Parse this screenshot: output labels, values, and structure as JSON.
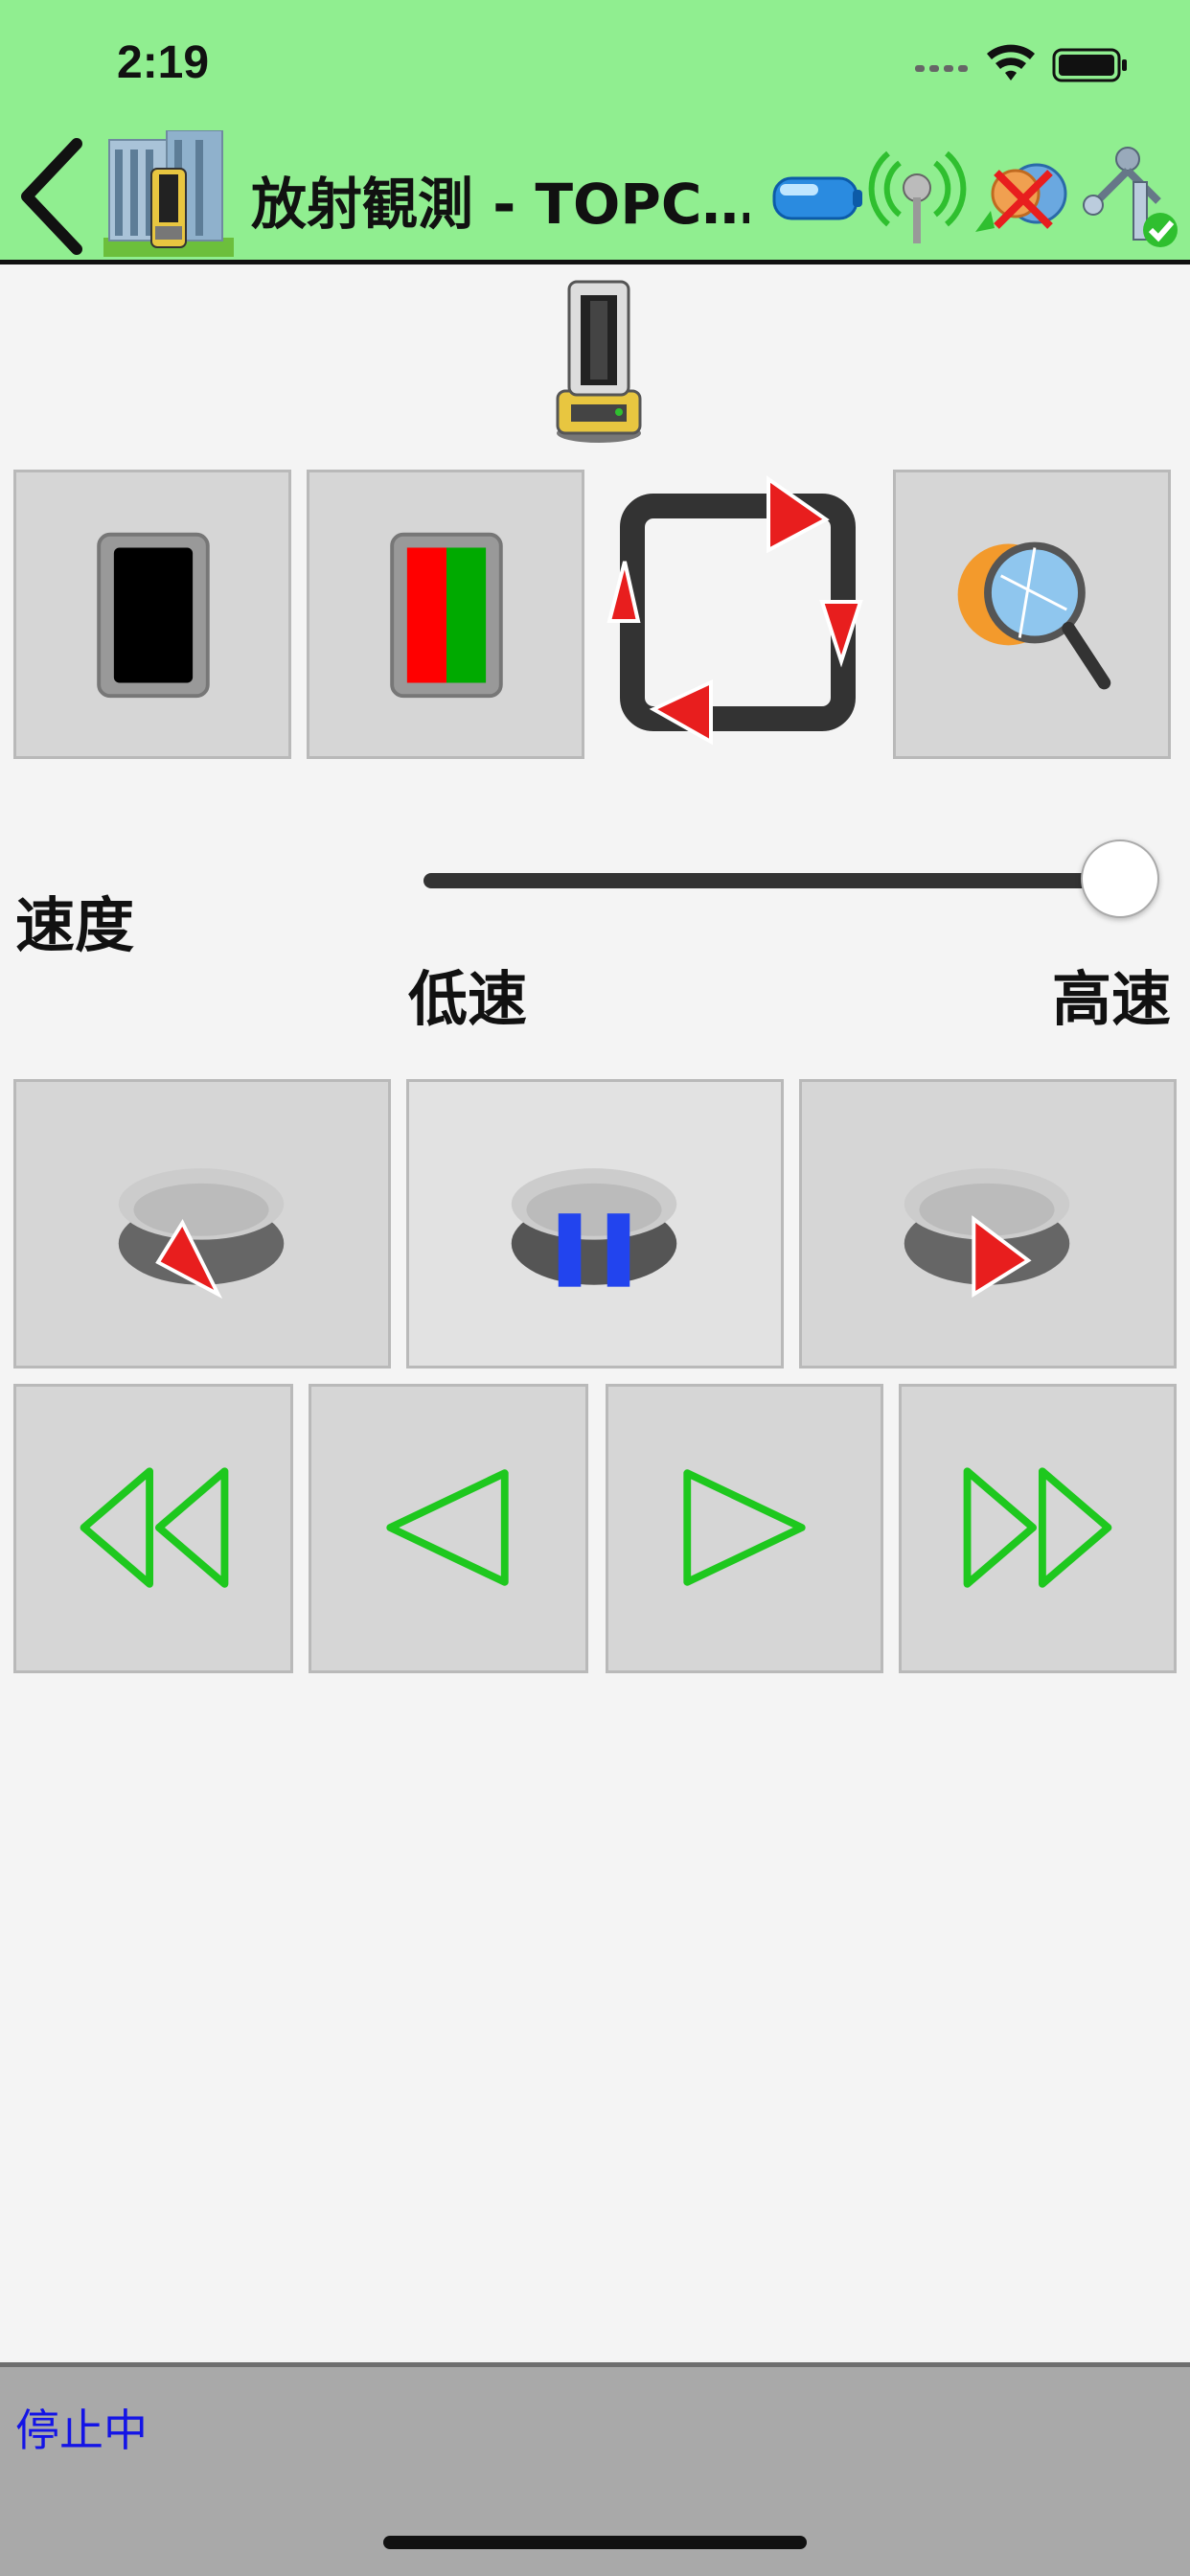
{
  "status_bar": {
    "time": "2:19"
  },
  "nav": {
    "title": "放射観測 - TOPC…",
    "status_icons": [
      "battery-icon",
      "radio-signal-icon",
      "prism-unlock-icon",
      "instrument-ok-icon"
    ]
  },
  "tool_buttons": [
    {
      "icon": "black-panel-icon"
    },
    {
      "icon": "red-green-panel-icon"
    },
    {
      "icon": "rotate-cycle-icon"
    },
    {
      "icon": "search-prism-icon"
    }
  ],
  "speed": {
    "label": "速度",
    "low_label": "低速",
    "high_label": "高速",
    "slider_value": 1.0
  },
  "rotation_buttons": [
    {
      "icon": "rotate-left-icon"
    },
    {
      "icon": "pause-rotation-icon"
    },
    {
      "icon": "rotate-right-icon"
    }
  ],
  "step_buttons": [
    {
      "icon": "fast-backward-icon"
    },
    {
      "icon": "step-backward-icon"
    },
    {
      "icon": "step-forward-icon"
    },
    {
      "icon": "fast-forward-icon"
    }
  ],
  "footer": {
    "status": "停止中"
  },
  "colors": {
    "header_bg": "#90ee90",
    "footer_text": "#1414e6",
    "arrow_green": "#1ec81e",
    "arrow_red": "#e81e1e"
  }
}
